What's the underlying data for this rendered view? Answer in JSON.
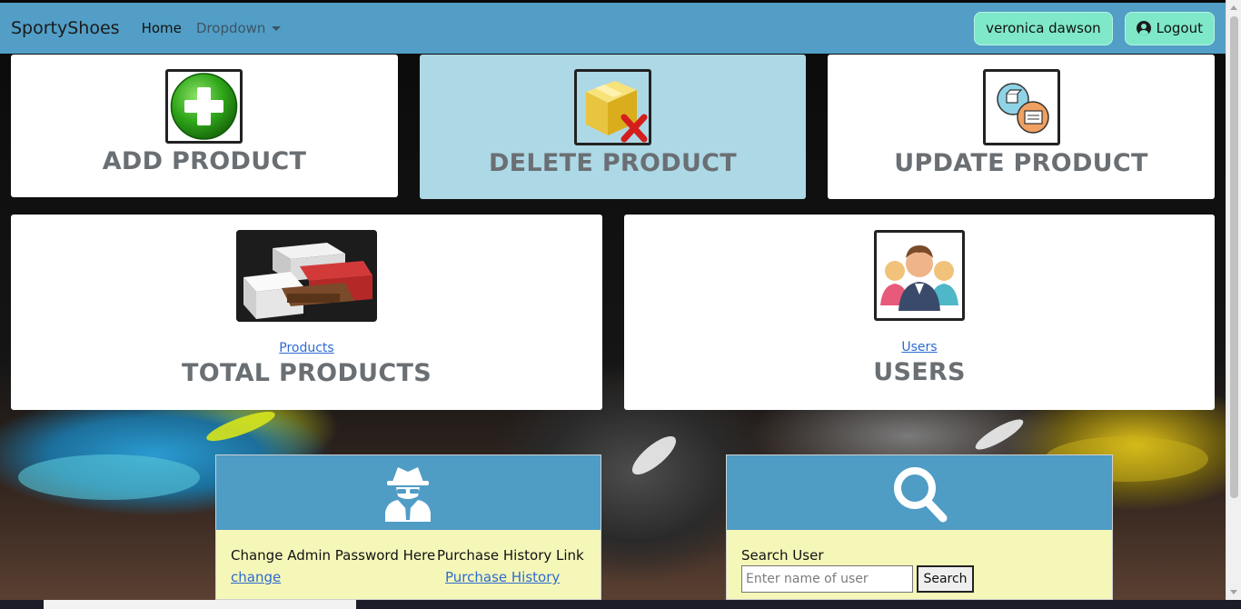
{
  "navbar": {
    "brand": "SportyShoes",
    "home": "Home",
    "dropdown": "Dropdown",
    "user_name": "veronica dawson",
    "logout": "Logout"
  },
  "cards": {
    "add": {
      "title": "ADD PRODUCT"
    },
    "delete": {
      "title": "DELETE PRODUCT"
    },
    "update": {
      "title": "UPDATE PRODUCT"
    },
    "total": {
      "link": "Products",
      "title": "TOTAL PRODUCTS"
    },
    "users": {
      "link": "Users",
      "title": "USERS"
    }
  },
  "admin_panel": {
    "change_label": "Change Admin Password Here",
    "change_link": "change",
    "history_label": "Purchase History Link",
    "history_link": "Purchase History"
  },
  "search_panel": {
    "label": "Search User",
    "placeholder": "Enter name of user",
    "button": "Search"
  },
  "colors": {
    "navbar": "#529ec6",
    "pill": "#7ee8c9",
    "active_card": "#add8e6",
    "panel_head": "#4f9cc5",
    "panel_body": "#f5f7b8",
    "link": "#2d6bd0"
  },
  "icons": [
    "plus-circle-icon",
    "delete-box-icon",
    "update-boxes-icon",
    "shoe-boxes-image",
    "users-group-icon",
    "spy-icon",
    "magnifier-icon",
    "user-circle-icon",
    "caret-down-icon"
  ]
}
